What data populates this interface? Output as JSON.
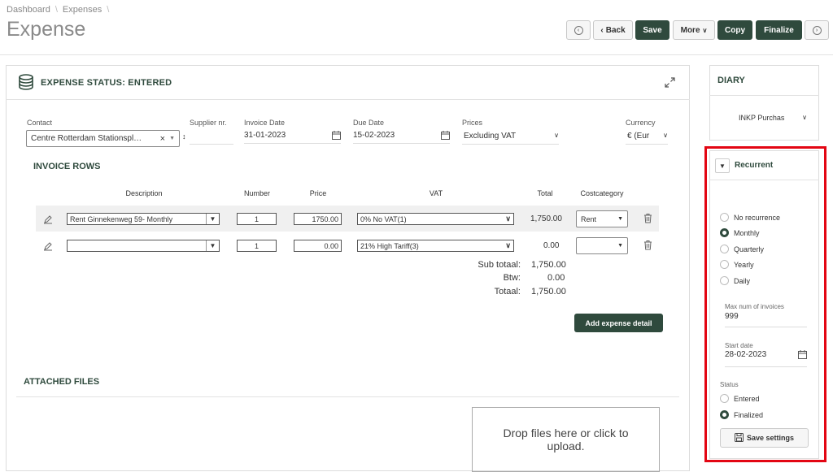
{
  "breadcrumb": [
    "Dashboard",
    "Expenses"
  ],
  "title": "Expense",
  "toolbar": {
    "back": "Back",
    "save": "Save",
    "more": "More",
    "copy": "Copy",
    "finalize": "Finalize"
  },
  "status": {
    "heading": "EXPENSE STATUS: ENTERED"
  },
  "fields": {
    "contact_label": "Contact",
    "contact_value": "Centre Rotterdam Stationspl…",
    "supplier_label": "Supplier nr.",
    "supplier_value": "",
    "invoice_date_label": "Invoice Date",
    "invoice_date_value": "31-01-2023",
    "due_date_label": "Due Date",
    "due_date_value": "15-02-2023",
    "prices_label": "Prices",
    "prices_value": "Excluding VAT",
    "currency_label": "Currency",
    "currency_value": "€ (Eur"
  },
  "invoice_rows": {
    "heading": "INVOICE ROWS",
    "columns": [
      "Description",
      "Number",
      "Price",
      "VAT",
      "Total",
      "Costcategory"
    ],
    "rows": [
      {
        "description": "Rent Ginnekenweg 59- Monthly",
        "number": "1",
        "price": "1750.00",
        "vat": "0% No VAT(1)",
        "total": "1,750.00",
        "costcategory": "Rent"
      },
      {
        "description": "",
        "number": "1",
        "price": "0.00",
        "vat": "21% High Tariff(3)",
        "total": "0.00",
        "costcategory": ""
      }
    ],
    "subtotal_label": "Sub totaal:",
    "subtotal_value": "1,750.00",
    "btw_label": "Btw:",
    "btw_value": "0.00",
    "total_label": "Totaal:",
    "total_value": "1,750.00",
    "add_button": "Add expense detail"
  },
  "attached": {
    "heading": "ATTACHED FILES",
    "dropzone": "Drop files here or click to upload."
  },
  "diary": {
    "heading": "DIARY",
    "value": "INKP Purchas"
  },
  "recurrent": {
    "heading": "Recurrent",
    "options": [
      {
        "label": "No recurrence",
        "selected": false
      },
      {
        "label": "Monthly",
        "selected": true
      },
      {
        "label": "Quarterly",
        "selected": false
      },
      {
        "label": "Yearly",
        "selected": false
      },
      {
        "label": "Daily",
        "selected": false
      }
    ],
    "max_label": "Max num of invoices",
    "max_value": "999",
    "start_label": "Start date",
    "start_value": "28-02-2023",
    "status_label": "Status",
    "status_options": [
      {
        "label": "Entered",
        "selected": false
      },
      {
        "label": "Finalized",
        "selected": true
      }
    ],
    "save_button": "Save settings"
  },
  "colors": {
    "accent": "#2f4a3d",
    "highlight": "#e30613"
  }
}
